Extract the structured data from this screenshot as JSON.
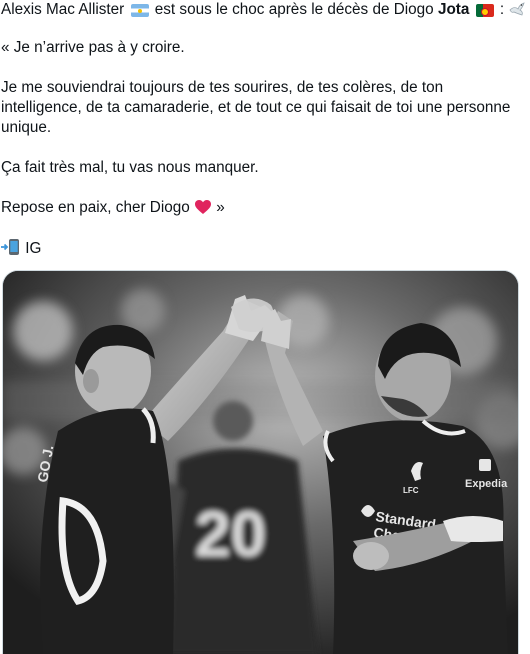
{
  "tweet": {
    "line1": {
      "part1": "Alexis Mac Allister",
      "part2": "est sous le choc après le décès de Diogo",
      "bold": "Jota",
      "part3": ":",
      "flag_left": "argentina-flag-icon",
      "flag_right": "portugal-flag-icon",
      "trailing_icon": "dove-icon"
    },
    "p1": "« Je n’arrive pas à y croire.",
    "p2_l1": "Je me souviendrai toujours de tes sourires, de tes colères, de ton",
    "p2_l2": "intelligence, de ta camaraderie, et de tout ce qui faisait de toi une personne",
    "p2_l3": "unique.",
    "p3": "Ça fait très mal, tu vas nous manquer.",
    "p4_text": "Repose en paix, cher Diogo",
    "p4_end": "»",
    "p4_icon": "red-heart-icon",
    "source_icon": "mobile-phone-arrow-icon",
    "source": "IG"
  },
  "media": {
    "jersey_number": "20",
    "shirt_text_left": "GO J.",
    "sponsor_1": "Standard",
    "sponsor_2": "Chartered",
    "sponsor_3": "Expedia",
    "club_crest": "LFC"
  },
  "colors": {
    "text": "#0f1419",
    "border": "#cfd9de",
    "heart": "#e0245e"
  }
}
